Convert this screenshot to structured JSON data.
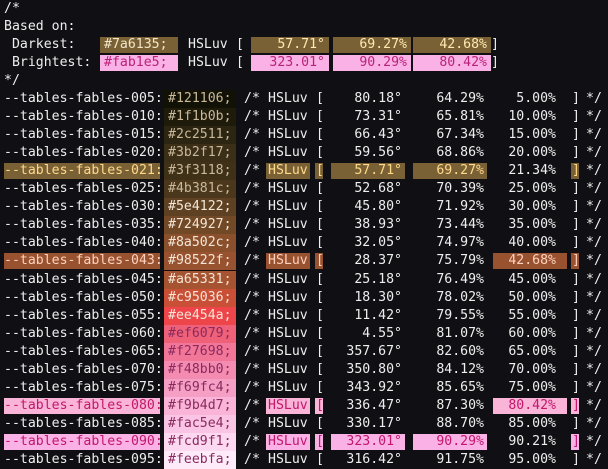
{
  "header": {
    "comment_open": "/*",
    "based_on": "Based on:",
    "darkest": {
      "label": " Darkest:",
      "hex": "#7a6135;",
      "model": "HSLuv",
      "bracket_open": "[",
      "h": "57.71°",
      "s": "69.27%",
      "l": "42.68%",
      "bracket_close": "]",
      "color": "#7a6135"
    },
    "brightest": {
      "label": " Brightest:",
      "hex": "#fab1e5;",
      "model": "HSLuv",
      "bracket_open": "[",
      "h": "323.01°",
      "s": "90.29%",
      "l": "80.42%",
      "bracket_close": "]",
      "color": "#fab1e5"
    },
    "comment_close": "*/"
  },
  "row_labels": {
    "comment_open": "/*",
    "model": "HSLuv",
    "bracket_open": "[",
    "bracket_close": "]",
    "comment_close": "*/"
  },
  "rows": [
    {
      "name": "--tables-fables-005:",
      "hex": "#121106;",
      "color": "#121106",
      "h": "80.18°",
      "s": "64.29%",
      "l": "5.00%"
    },
    {
      "name": "--tables-fables-010:",
      "hex": "#1f1b0b;",
      "color": "#1f1b0b",
      "h": "73.31°",
      "s": "65.81%",
      "l": "10.00%"
    },
    {
      "name": "--tables-fables-015:",
      "hex": "#2c2511;",
      "color": "#2c2511",
      "h": "66.43°",
      "s": "67.34%",
      "l": "15.00%"
    },
    {
      "name": "--tables-fables-020:",
      "hex": "#3b2f17;",
      "color": "#3b2f17",
      "h": "59.56°",
      "s": "68.86%",
      "l": "20.00%"
    },
    {
      "name": "--tables-fables-021:",
      "hex": "#3f3118;",
      "color": "#3f3118",
      "h": "57.71°",
      "s": "69.27%",
      "l": "21.34%",
      "hl": "dark"
    },
    {
      "name": "--tables-fables-025:",
      "hex": "#4b381c;",
      "color": "#4b381c",
      "h": "52.68°",
      "s": "70.39%",
      "l": "25.00%"
    },
    {
      "name": "--tables-fables-030:",
      "hex": "#5e4122;",
      "color": "#5e4122",
      "h": "45.80°",
      "s": "71.92%",
      "l": "30.00%"
    },
    {
      "name": "--tables-fables-035:",
      "hex": "#724927;",
      "color": "#724927",
      "h": "38.93°",
      "s": "73.44%",
      "l": "35.00%"
    },
    {
      "name": "--tables-fables-040:",
      "hex": "#8a502c;",
      "color": "#8a502c",
      "h": "32.05°",
      "s": "74.97%",
      "l": "40.00%"
    },
    {
      "name": "--tables-fables-043:",
      "hex": "#98522f;",
      "color": "#98522f",
      "h": "28.37°",
      "s": "75.79%",
      "l": "42.68%",
      "hl": "mid"
    },
    {
      "name": "--tables-fables-045:",
      "hex": "#a65331;",
      "color": "#a65331",
      "h": "25.18°",
      "s": "76.49%",
      "l": "45.00%"
    },
    {
      "name": "--tables-fables-050:",
      "hex": "#c95036;",
      "color": "#c95036",
      "h": "18.30°",
      "s": "78.02%",
      "l": "50.00%"
    },
    {
      "name": "--tables-fables-055:",
      "hex": "#ee454a;",
      "color": "#ee454a",
      "h": "11.42°",
      "s": "79.55%",
      "l": "55.00%"
    },
    {
      "name": "--tables-fables-060:",
      "hex": "#ef6079;",
      "color": "#ef6079",
      "h": "4.55°",
      "s": "81.07%",
      "l": "60.00%"
    },
    {
      "name": "--tables-fables-065:",
      "hex": "#f27698;",
      "color": "#f27698",
      "h": "357.67°",
      "s": "82.60%",
      "l": "65.00%"
    },
    {
      "name": "--tables-fables-070:",
      "hex": "#f48bb0;",
      "color": "#f48bb0",
      "h": "350.80°",
      "s": "84.12%",
      "l": "70.00%"
    },
    {
      "name": "--tables-fables-075:",
      "hex": "#f69fc4;",
      "color": "#f69fc4",
      "h": "343.92°",
      "s": "85.65%",
      "l": "75.00%"
    },
    {
      "name": "--tables-fables-080:",
      "hex": "#f9b4d7;",
      "color": "#f9b4d7",
      "h": "336.47°",
      "s": "87.30%",
      "l": "80.42%",
      "hl": "bright"
    },
    {
      "name": "--tables-fables-085:",
      "hex": "#fac5e4;",
      "color": "#fac5e4",
      "h": "330.17°",
      "s": "88.70%",
      "l": "85.00%"
    },
    {
      "name": "--tables-fables-090:",
      "hex": "#fcd9f1;",
      "color": "#fcd9f1",
      "h": "323.01°",
      "s": "90.29%",
      "l": "90.21%",
      "hl": "brightest"
    },
    {
      "name": "--tables-fables-095:",
      "hex": "#feebfa;",
      "color": "#feebfa",
      "h": "316.42°",
      "s": "91.75%",
      "l": "95.00%"
    }
  ],
  "colors": {
    "background": "#101014",
    "text": "#eeeeee",
    "dark_highlight": "#7a6135",
    "mid_highlight": "#98522f",
    "bright_highlight": "#f9b4d7",
    "brightest_highlight": "#fab1e5"
  }
}
